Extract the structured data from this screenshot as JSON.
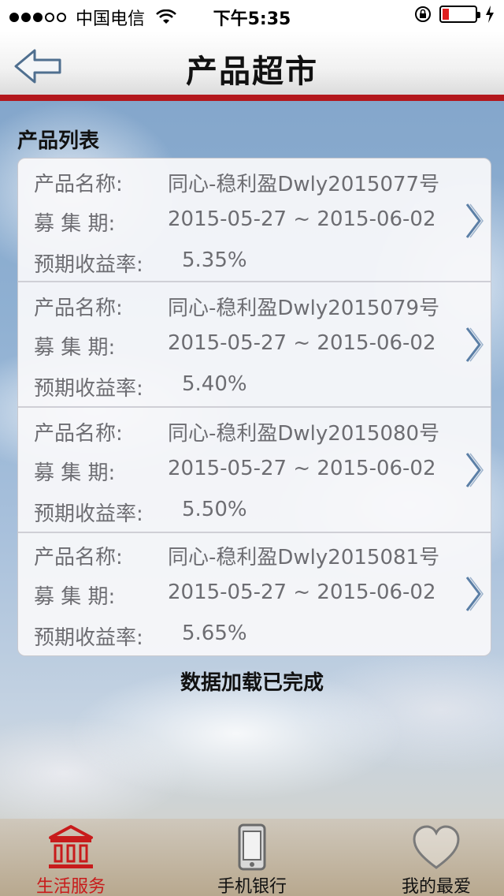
{
  "status_bar": {
    "carrier": "中国电信",
    "time": "下午5:35",
    "battery_level": 0.2
  },
  "nav": {
    "title": "产品超市",
    "back_icon": "back-arrow-icon"
  },
  "list_title": "产品列表",
  "items": [
    {
      "name_label": "产品名称:",
      "name": "同心-稳利盈Dwly2015077号",
      "period_label": "募 集 期:",
      "period": "2015-05-27 ~ 2015-06-02",
      "rate_label": "预期收益率:",
      "rate": "5.35%"
    },
    {
      "name_label": "产品名称:",
      "name": "同心-稳利盈Dwly2015079号",
      "period_label": "募 集 期:",
      "period": "2015-05-27 ~ 2015-06-02",
      "rate_label": "预期收益率:",
      "rate": "5.40%"
    },
    {
      "name_label": "产品名称:",
      "name": "同心-稳利盈Dwly2015080号",
      "period_label": "募 集 期:",
      "period": "2015-05-27 ~ 2015-06-02",
      "rate_label": "预期收益率:",
      "rate": "5.50%"
    },
    {
      "name_label": "产品名称:",
      "name": "同心-稳利盈Dwly2015081号",
      "period_label": "募 集 期:",
      "period": "2015-05-27 ~ 2015-06-02",
      "rate_label": "预期收益率:",
      "rate": "5.65%"
    }
  ],
  "load_status": "数据加载已完成",
  "tabs": [
    {
      "label": "生活服务",
      "icon": "bank-building-icon",
      "active": true
    },
    {
      "label": "手机银行",
      "icon": "mobile-phone-icon",
      "active": false
    },
    {
      "label": "我的最爱",
      "icon": "heart-icon",
      "active": false
    }
  ],
  "colors": {
    "accent_red": "#b3171c",
    "active_tab": "#c81b1b",
    "chevron": "#5b7fa6"
  }
}
